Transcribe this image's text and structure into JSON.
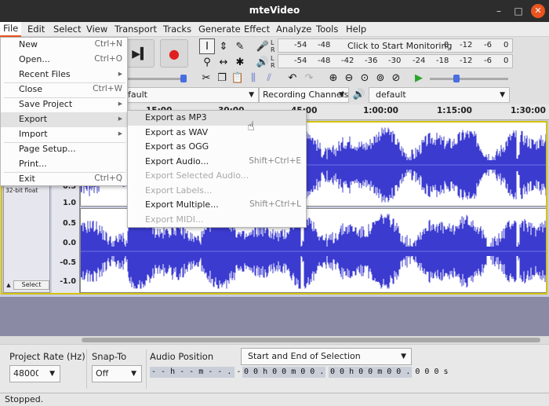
{
  "window": {
    "title": "mteVideo"
  },
  "menubar": [
    "File",
    "Edit",
    "Select",
    "View",
    "Transport",
    "Tracks",
    "Generate",
    "Effect",
    "Analyze",
    "Tools",
    "Help"
  ],
  "meter": {
    "record_ticks": [
      "-54",
      "-48",
      "Click to Start Monitoring",
      "8",
      "-12",
      "-6",
      "0"
    ],
    "play_ticks": [
      "-54",
      "-48",
      "-42",
      "-36",
      "-30",
      "-24",
      "-18",
      "-12",
      "-6",
      "0"
    ]
  },
  "device": {
    "host": "fault",
    "channels": "Recording Channels",
    "output": "default"
  },
  "ruler": [
    "15:00",
    "30:00",
    "45:00",
    "1:00:00",
    "1:15:00",
    "1:30:00"
  ],
  "track": {
    "info": "32-bit float",
    "select_label": "Select",
    "scale_top": [
      "0.5",
      "1.0",
      "0.5",
      "0.0",
      "-0.5",
      "-1.0"
    ],
    "scale_bottom": [
      "1.0",
      "0.5",
      "0.0",
      "-0.5",
      "-1.0"
    ],
    "color": "#3b3bd0"
  },
  "file_menu": [
    {
      "label": "New",
      "accel": "Ctrl+N"
    },
    {
      "label": "Open...",
      "accel": "Ctrl+O"
    },
    {
      "label": "Recent Files",
      "accel": "▸"
    },
    {
      "label": "Close",
      "accel": "Ctrl+W"
    },
    {
      "label": "Save Project",
      "accel": "▸"
    },
    {
      "label": "Export",
      "accel": "▸"
    },
    {
      "label": "Import",
      "accel": "▸"
    },
    {
      "label": "Page Setup...",
      "accel": ""
    },
    {
      "label": "Print...",
      "accel": ""
    },
    {
      "label": "Exit",
      "accel": "Ctrl+Q"
    }
  ],
  "export_menu": [
    {
      "label": "Export as MP3",
      "accel": ""
    },
    {
      "label": "Export as WAV",
      "accel": ""
    },
    {
      "label": "Export as OGG",
      "accel": ""
    },
    {
      "label": "Export Audio...",
      "accel": "Shift+Ctrl+E"
    },
    {
      "label": "Export Selected Audio...",
      "accel": ""
    },
    {
      "label": "Export Labels...",
      "accel": ""
    },
    {
      "label": "Export Multiple...",
      "accel": "Shift+Ctrl+L"
    },
    {
      "label": "Export MIDI...",
      "accel": ""
    }
  ],
  "selection_toolbar": {
    "project_rate_label": "Project Rate (Hz)",
    "project_rate_value": "48000",
    "snap_label": "Snap-To",
    "snap_value": "Off",
    "audio_position_label": "Audio Position",
    "audio_position_value": "- - h - - m - - . - - - s",
    "selection_mode": "Start and End of Selection",
    "sel_start": "0 0 h 0 0 m 0 0 . 0 0 0 s",
    "sel_end": "0 0 h 0 0 m 0 0 . 0 0 0 s"
  },
  "status": "Stopped.",
  "colors": {
    "accent": "#e9541f",
    "waveform": "#3b3bd0",
    "track_frame": "#d4c200"
  }
}
